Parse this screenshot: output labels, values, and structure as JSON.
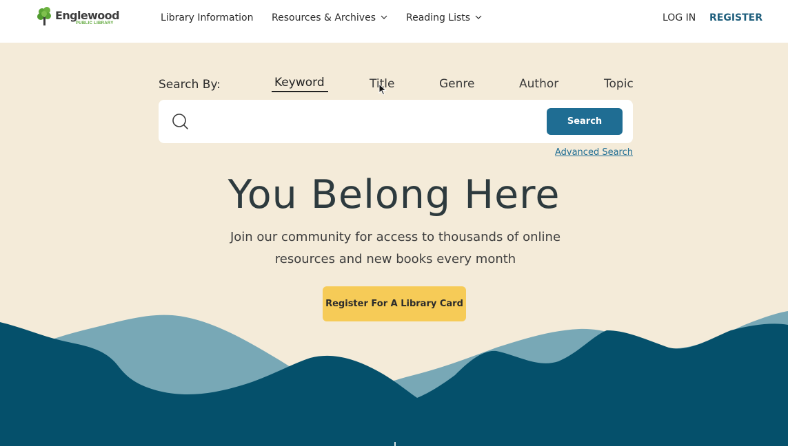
{
  "header": {
    "logo_name": "Englewood",
    "logo_sub": "PUBLIC LIBRARY",
    "nav": {
      "library_info": "Library Information",
      "resources": "Resources & Archives",
      "reading_lists": "Reading Lists",
      "login": "LOG IN",
      "register": "REGISTER"
    }
  },
  "search": {
    "label": "Search By:",
    "tabs": [
      "Keyword",
      "Title",
      "Genre",
      "Author",
      "Topic"
    ],
    "active_tab": "Keyword",
    "input_value": "",
    "input_placeholder": "",
    "button_label": "Search",
    "advanced_link": "Advanced Search"
  },
  "hero": {
    "title": "You Belong Here",
    "subtitle": "Join our community for access to thousands of online resources and new books every month",
    "cta_label": "Register For A Library Card"
  },
  "colors": {
    "page_bg": "#f4ebd9",
    "brand_blue": "#1f6d93",
    "register_text": "#1f5f7d",
    "cta_yellow": "#f6cb57",
    "mountain_dark": "#05506b",
    "mountain_light": "#78a8b6",
    "logo_green": "#5aa535"
  },
  "icons": {
    "logo": "tree-logo-icon",
    "chevron": "chevron-down-icon",
    "search": "search-icon",
    "cursor": "mouse-pointer-icon"
  }
}
